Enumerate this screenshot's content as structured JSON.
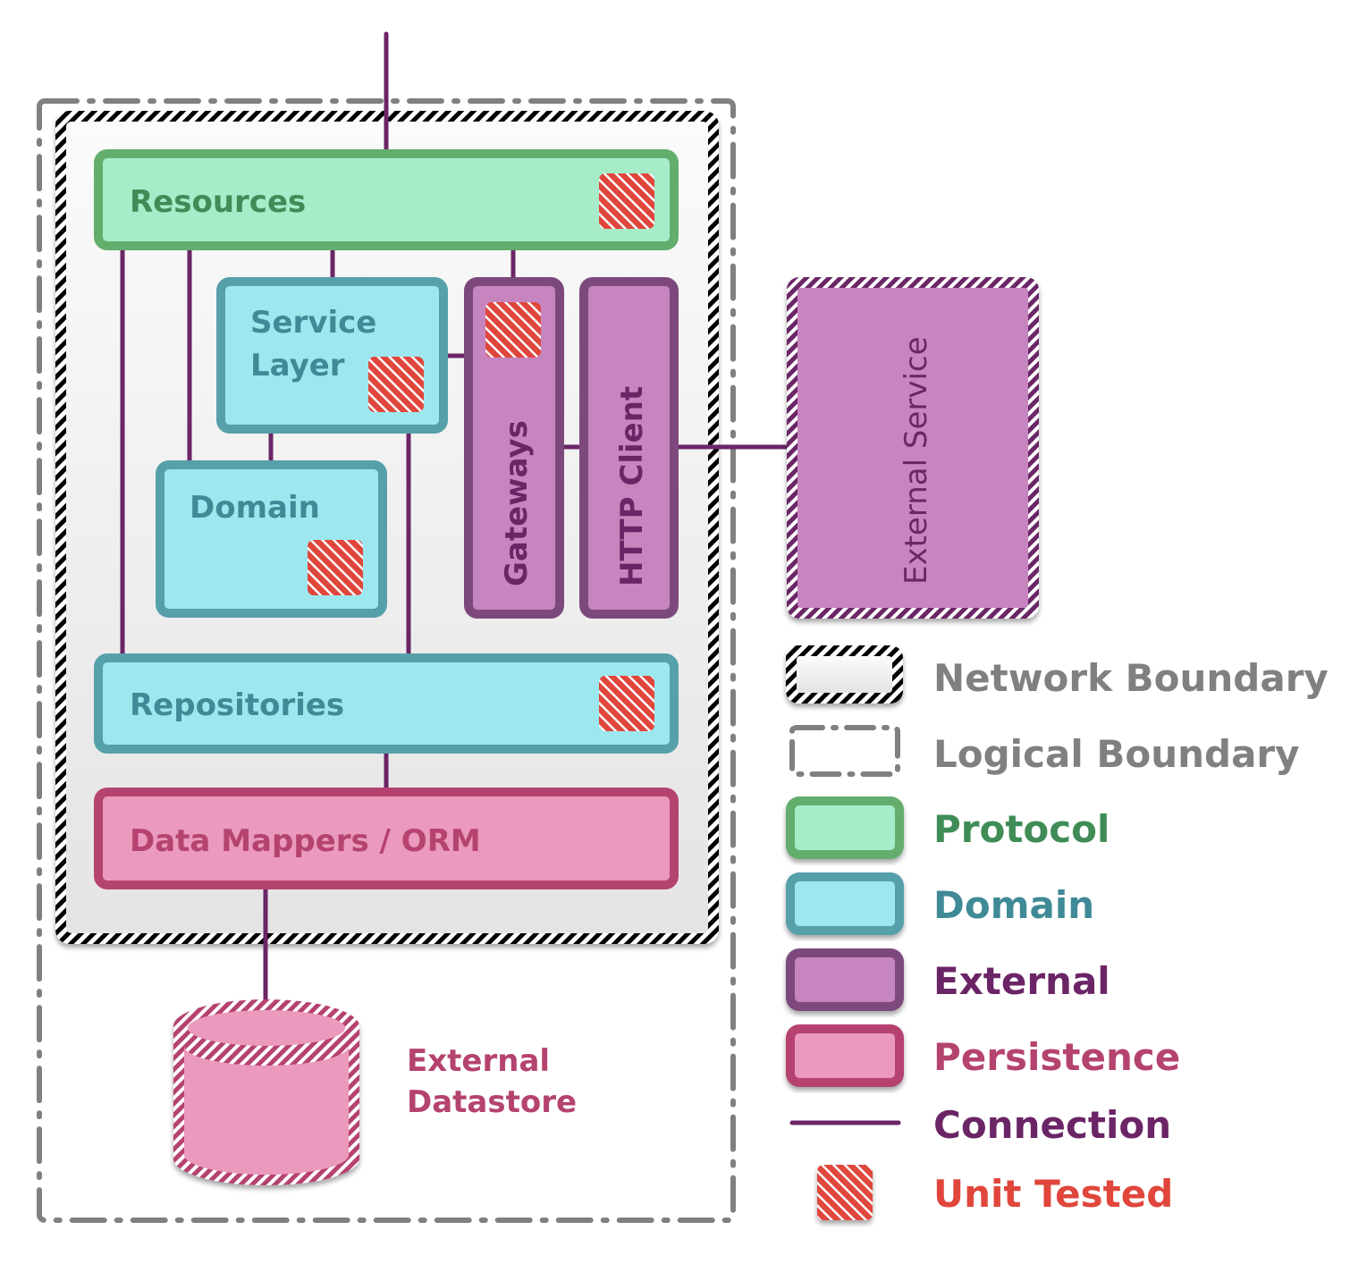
{
  "diagram": {
    "components": {
      "resources": "Resources",
      "service_layer_line1": "Service",
      "service_layer_line2": "Layer",
      "domain": "Domain",
      "gateways": "Gateways",
      "http_client": "HTTP Client",
      "repositories": "Repositories",
      "data_mappers": "Data Mappers / ORM",
      "external_service": "External Service",
      "external_datastore_line1": "External",
      "external_datastore_line2": "Datastore"
    },
    "unit_tested": [
      "resources",
      "service_layer",
      "domain",
      "gateways",
      "repositories"
    ]
  },
  "legend": {
    "items": [
      {
        "key": "network",
        "label": "Network Boundary",
        "color": "#808080"
      },
      {
        "key": "logical",
        "label": "Logical Boundary",
        "color": "#808080"
      },
      {
        "key": "protocol",
        "label": "Protocol",
        "color": "#3f8c57"
      },
      {
        "key": "domain",
        "label": "Domain",
        "color": "#3f8a96"
      },
      {
        "key": "external",
        "label": "External",
        "color": "#6b2566"
      },
      {
        "key": "persistence",
        "label": "Persistence",
        "color": "#b5436f"
      },
      {
        "key": "connection",
        "label": "Connection",
        "color": "#6b2566"
      },
      {
        "key": "unit",
        "label": "Unit  Tested",
        "color": "#e0463c"
      }
    ]
  },
  "colors": {
    "protocol_fill": "#a6ecc9",
    "protocol_stroke": "#63ad6d",
    "protocol_text": "#3f8c57",
    "domain_fill": "#9ce8ee",
    "domain_stroke": "#56a0aa",
    "domain_text": "#3f8a96",
    "external_fill": "#c785c0",
    "external_stroke": "#7d497d",
    "external_text": "#6b2566",
    "persistence_fill": "#eb99bd",
    "persistence_stroke": "#b5436f",
    "persistence_text": "#b5436f",
    "connection": "#6b2566",
    "unit_tested": "#e0463c",
    "boundary_gray": "#808080"
  }
}
